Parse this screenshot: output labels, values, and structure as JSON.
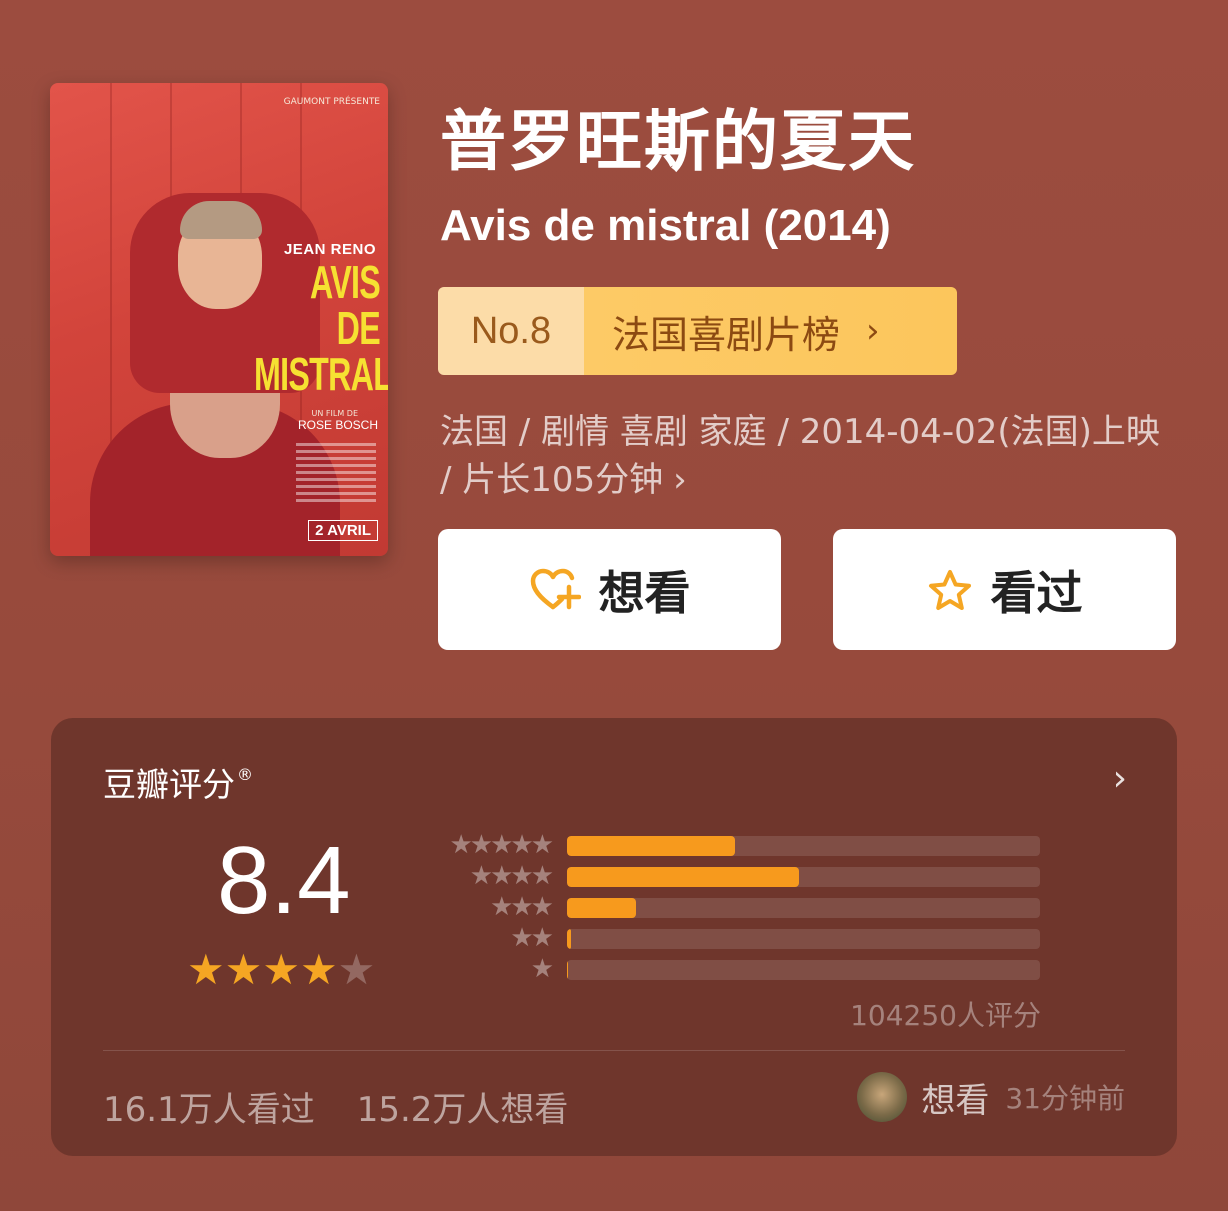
{
  "movie": {
    "title_cn": "普罗旺斯的夏天",
    "title_en": "Avis de mistral (2014)",
    "poster": {
      "studio": "GAUMONT PRÉSENTE",
      "actor": "JEAN RENO",
      "title_lines": [
        "AVIS",
        "DE",
        "MISTRAL"
      ],
      "director_prefix": "UN FILM DE",
      "director": "ROSE BOSCH",
      "release": "2 AVRIL"
    },
    "ranking": {
      "number": "No.8",
      "list_name": "法国喜剧片榜",
      "chevron": "›"
    },
    "meta_line": "法国 / 剧情 喜剧 家庭 / 2014-04-02(法国)上映 / 片长105分钟",
    "meta_arrow": "›"
  },
  "actions": {
    "want": {
      "label": "想看",
      "icon": "heart-plus-icon"
    },
    "seen": {
      "label": "看过",
      "icon": "star-outline-icon"
    }
  },
  "rating": {
    "header": "豆瓣评分",
    "header_mark": "®",
    "chevron": "›",
    "score": "8.4",
    "stars": {
      "filled": 4,
      "total": 5
    },
    "distribution": [
      {
        "stars": 5,
        "stars_text": "★★★★★",
        "percent": 35.5
      },
      {
        "stars": 4,
        "stars_text": "★★★★",
        "percent": 49
      },
      {
        "stars": 3,
        "stars_text": "★★★",
        "percent": 14.5
      },
      {
        "stars": 2,
        "stars_text": "★★",
        "percent": 0.8
      },
      {
        "stars": 1,
        "stars_text": "★",
        "percent": 0.2
      }
    ],
    "raters": "104250人评分",
    "seen_count": "16.1万人看过",
    "want_count": "15.2万人想看",
    "activity": {
      "label": "想看",
      "time": "31分钟前"
    }
  },
  "colors": {
    "background": "#9c4c3f",
    "card": "#6f362c",
    "accent": "#f79a1d",
    "rank_tag": "#fcca60",
    "star_on": "#f5a623"
  }
}
